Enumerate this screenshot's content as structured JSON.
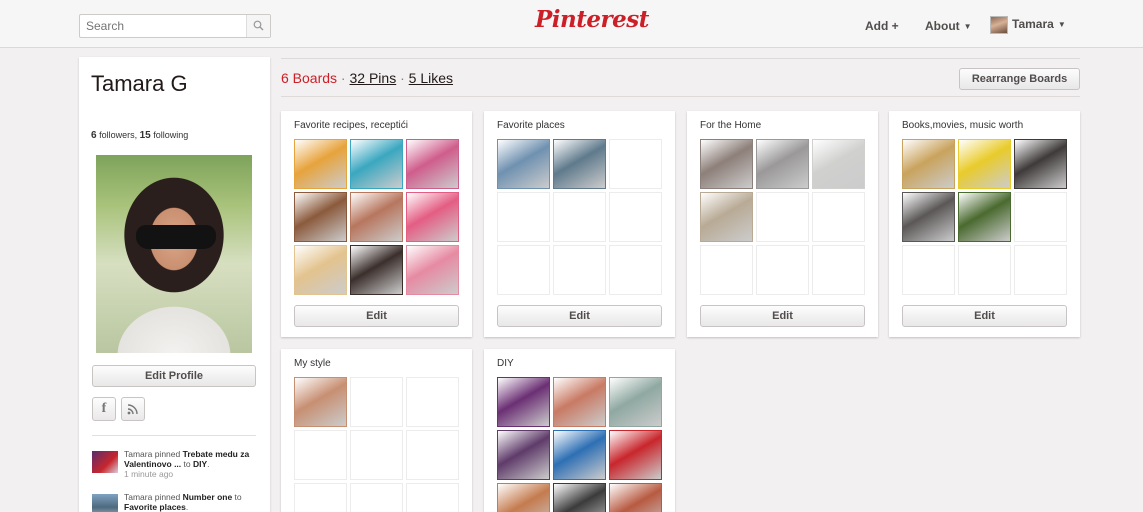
{
  "header": {
    "search_placeholder": "Search",
    "logo": "Pinterest",
    "nav_add": "Add +",
    "nav_about": "About",
    "nav_user": "Tamara"
  },
  "profile": {
    "name": "Tamara G",
    "followers_count": "6",
    "followers_label": "followers,",
    "following_count": "15",
    "following_label": "following",
    "edit_profile": "Edit Profile",
    "activity": [
      {
        "prefix": "Tamara pinned ",
        "pin": "Trebate medu za Valentinovo ...",
        "to": " to ",
        "board": "DIY",
        "suffix": ".",
        "time": "1 minute ago"
      },
      {
        "prefix": "Tamara pinned ",
        "pin": "Number one",
        "to": " to ",
        "board": "Favorite places",
        "suffix": ".",
        "time": ""
      }
    ]
  },
  "stats": {
    "boards": "6 Boards",
    "sep1": " · ",
    "pins": "32 Pins",
    "sep2": " · ",
    "likes": "5 Likes",
    "rearrange": "Rearrange Boards"
  },
  "boards": [
    {
      "title": "Favorite recipes, receptići",
      "edit": "Edit",
      "thumbs": [
        "#e7a33c",
        "#3aa7c0",
        "#cf5d8c",
        "#8b5a3c",
        "#b7765e",
        "#e45d83",
        "#e3c38e",
        "#3b2f2c",
        "#e68aa2"
      ]
    },
    {
      "title": "Favorite places",
      "edit": "Edit",
      "thumbs": [
        "#6f91b0",
        "#5f7a8c"
      ]
    },
    {
      "title": "For the Home",
      "edit": "Edit",
      "thumbs": [
        "#8d7f79",
        "#9a9898",
        "#d0d0cf",
        "#b8aa95"
      ]
    },
    {
      "title": "Books,movies, music worth",
      "edit": "Edit",
      "thumbs": [
        "#c9a35d",
        "#e9cb2b",
        "#3f3a3a",
        "#5b5757",
        "#4a6a2f"
      ]
    },
    {
      "title": "My style",
      "edit": "",
      "thumbs": [
        "#c78f72"
      ]
    },
    {
      "title": "DIY",
      "edit": "",
      "thumbs": [
        "#6b2f74",
        "#c87a64",
        "#8fa8a1",
        "#5f3b6a",
        "#2d6fb4",
        "#c8262c",
        "#c47b4e",
        "#3b3b3b",
        "#b85a41"
      ]
    }
  ]
}
